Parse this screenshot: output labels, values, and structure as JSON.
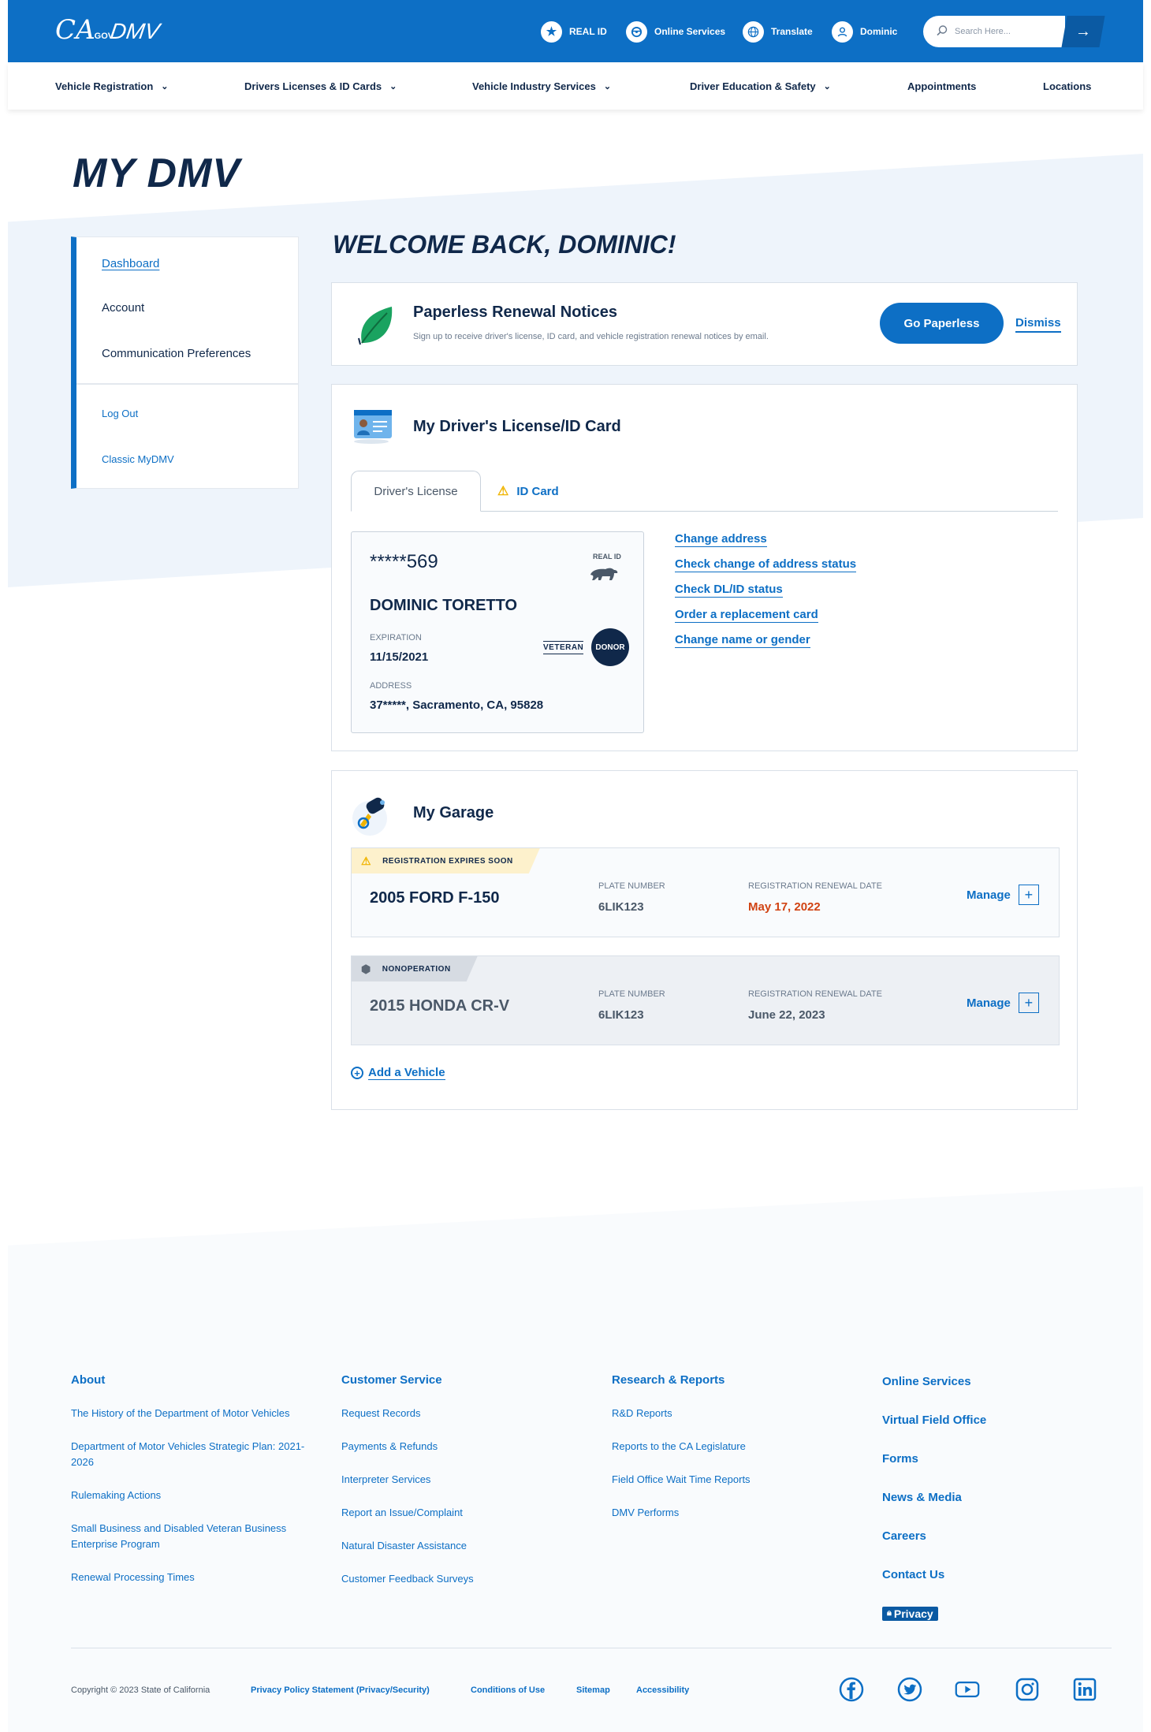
{
  "header": {
    "ca_logo": "CA",
    "ca_logo_suffix": ".GOV",
    "dmv_logo": "DMV",
    "real_id": "REAL ID",
    "online_services": "Online Services",
    "translate": "Translate",
    "user": "Dominic",
    "search_placeholder": "Search Here..."
  },
  "nav": [
    {
      "label": "Vehicle Registration",
      "dropdown": true
    },
    {
      "label": "Drivers Licenses & ID Cards",
      "dropdown": true
    },
    {
      "label": "Vehicle Industry Services",
      "dropdown": true
    },
    {
      "label": "Driver Education & Safety",
      "dropdown": true
    },
    {
      "label": "Appointments",
      "dropdown": false
    },
    {
      "label": "Locations",
      "dropdown": false
    }
  ],
  "page_title": "MY DMV",
  "sidebar": {
    "items": [
      "Dashboard",
      "Account",
      "Communication Preferences"
    ],
    "links": [
      "Log Out",
      "Classic MyDMV"
    ]
  },
  "welcome": "WELCOME BACK, DOMINIC!",
  "paperless": {
    "title": "Paperless Renewal Notices",
    "subtitle": "Sign up to receive driver's license, ID card, and vehicle registration renewal notices by email.",
    "button": "Go Paperless",
    "dismiss": "Dismiss"
  },
  "license": {
    "title": "My Driver's License/ID Card",
    "tabs": [
      "Driver's License",
      "ID Card"
    ],
    "number": "*****569",
    "real_id_label": "REAL ID",
    "name": "DOMINIC TORETTO",
    "expiration_label": "EXPIRATION",
    "expiration": "11/15/2021",
    "address_label": "ADDRESS",
    "address": "37*****, Sacramento, CA, 95828",
    "veteran": "VETERAN",
    "donor": "DONOR",
    "links": [
      "Change address",
      "Check change of address status",
      "Check DL/ID status",
      "Order a replacement card",
      "Change name or gender"
    ]
  },
  "garage": {
    "title": "My Garage",
    "plate_label": "PLATE NUMBER",
    "renewal_label": "REGISTRATION RENEWAL DATE",
    "manage": "Manage",
    "vehicles": [
      {
        "flag": "REGISTRATION EXPIRES SOON",
        "model": "2005 FORD F-150",
        "plate": "6LIK123",
        "renewal": "May 17, 2022"
      },
      {
        "flag": "NONOPERATION",
        "model": "2015 HONDA CR-V",
        "plate": "6LIK123",
        "renewal": "June 22, 2023"
      }
    ],
    "add": "Add a Vehicle"
  },
  "footer": {
    "about": {
      "head": "About",
      "links": [
        "The History of the Department of Motor Vehicles",
        "Department of Motor Vehicles Strategic Plan: 2021-2026",
        "Rulemaking Actions",
        "Small Business and Disabled Veteran Business Enterprise Program",
        "Renewal Processing Times"
      ]
    },
    "customer": {
      "head": "Customer Service",
      "links": [
        "Request Records",
        "Payments & Refunds",
        "Interpreter Services",
        "Report an Issue/Complaint",
        "Natural Disaster Assistance",
        "Customer Feedback Surveys"
      ]
    },
    "research": {
      "head": "Research & Reports",
      "links": [
        "R&D Reports",
        "Reports to the CA Legislature",
        "Field Office Wait Time Reports",
        "DMV Performs"
      ]
    },
    "services": {
      "links": [
        "Online Services",
        "Virtual Field Office",
        "Forms",
        "News & Media",
        "Careers",
        "Contact Us"
      ],
      "privacy_badge": "Privacy"
    },
    "copyright": "Copyright © 2023 State of California",
    "bottom_links": [
      "Privacy Policy Statement (Privacy/Security)",
      "Conditions of Use",
      "Sitemap",
      "Accessibility"
    ],
    "social": [
      "facebook-icon",
      "twitter-icon",
      "youtube-icon",
      "instagram-icon",
      "linkedin-icon"
    ]
  },
  "colors": {
    "primary": "#0d6fc5",
    "navy": "#10284a",
    "alert": "#d14313",
    "warning": "#f0b400"
  }
}
